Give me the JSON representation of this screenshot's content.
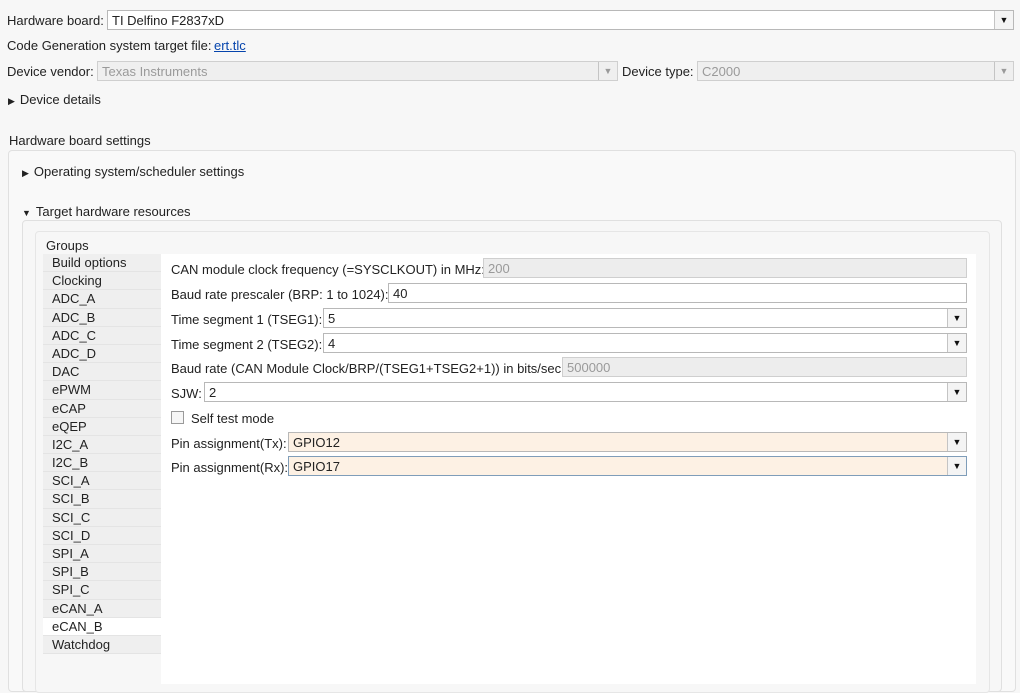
{
  "top": {
    "hardware_board_label": "Hardware board:",
    "hardware_board_value": "TI Delfino F2837xD",
    "target_file_label": "Code Generation system target file:",
    "target_file_link": "ert.tlc",
    "device_vendor_label": "Device vendor:",
    "device_vendor_value": "Texas Instruments",
    "device_type_label": "Device type:",
    "device_type_value": "C2000",
    "device_details": "Device details"
  },
  "settings": {
    "title": "Hardware board settings",
    "os_section": "Operating system/scheduler settings",
    "target_section": "Target hardware resources",
    "groups_label": "Groups",
    "groups": [
      "Build options",
      "Clocking",
      "ADC_A",
      "ADC_B",
      "ADC_C",
      "ADC_D",
      "DAC",
      "ePWM",
      "eCAP",
      "eQEP",
      "I2C_A",
      "I2C_B",
      "SCI_A",
      "SCI_B",
      "SCI_C",
      "SCI_D",
      "SPI_A",
      "SPI_B",
      "SPI_C",
      "eCAN_A",
      "eCAN_B",
      "Watchdog"
    ]
  },
  "ecan": {
    "clock_label": "CAN module clock frequency (=SYSCLKOUT) in MHz:",
    "clock_value": "200",
    "brp_label": "Baud rate prescaler (BRP: 1 to 1024):",
    "brp_value": "40",
    "tseg1_label": "Time segment 1 (TSEG1):",
    "tseg1_value": "5",
    "tseg2_label": "Time segment 2 (TSEG2):",
    "tseg2_value": "4",
    "baud_label": "Baud rate (CAN Module Clock/BRP/(TSEG1+TSEG2+1)) in bits/sec:",
    "baud_value": "500000",
    "sjw_label": "SJW:",
    "sjw_value": "2",
    "self_test_label": "Self test mode",
    "tx_label": "Pin assignment(Tx):",
    "tx_value": "GPIO12",
    "rx_label": "Pin assignment(Rx):",
    "rx_value": "GPIO17"
  }
}
